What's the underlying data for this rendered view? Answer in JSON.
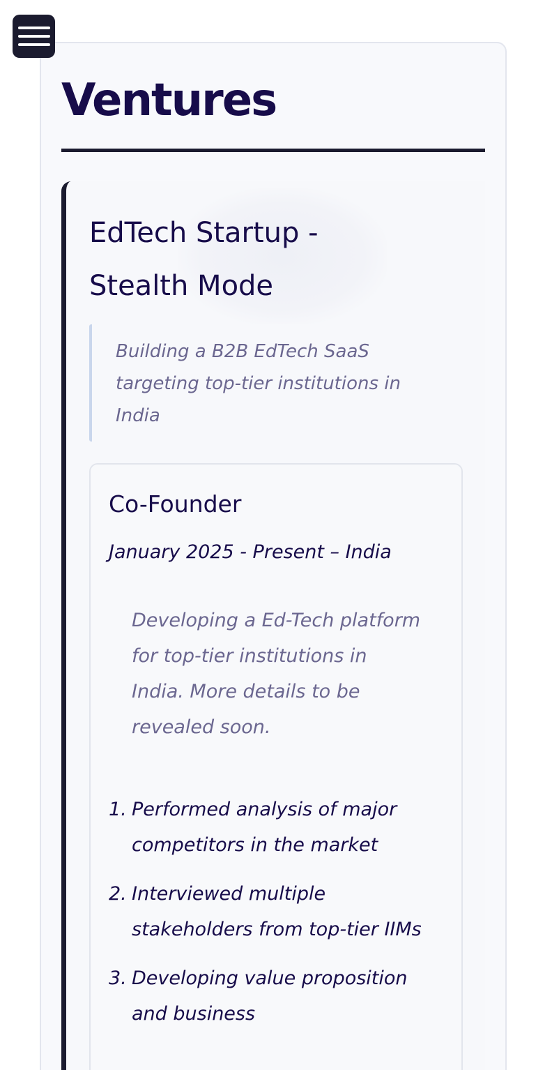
{
  "nav": {
    "menu_icon": "hamburger-menu-icon"
  },
  "section": {
    "title": "Ventures"
  },
  "venture": {
    "name": "EdTech Startup - Stealth Mode",
    "tagline": "Building a B2B EdTech SaaS targeting top-tier institutions in India",
    "role": {
      "title": "Co-Founder",
      "meta": "January 2025 - Present – India",
      "description": "Developing a Ed-Tech platform for top-tier institutions in India. More details to be revealed soon.",
      "achievements": [
        {
          "num": "1.",
          "text": "Performed analysis of major competitors in the market"
        },
        {
          "num": "2.",
          "text": "Interviewed multiple stakeholders from top-tier IIMs"
        },
        {
          "num": "3.",
          "text": "Developing value proposition and business"
        }
      ]
    }
  },
  "colors": {
    "heading": "#170c4a",
    "muted_text": "#6b6790",
    "dark_accent": "#1b1b2f",
    "quote_border": "#c9d6ec"
  }
}
